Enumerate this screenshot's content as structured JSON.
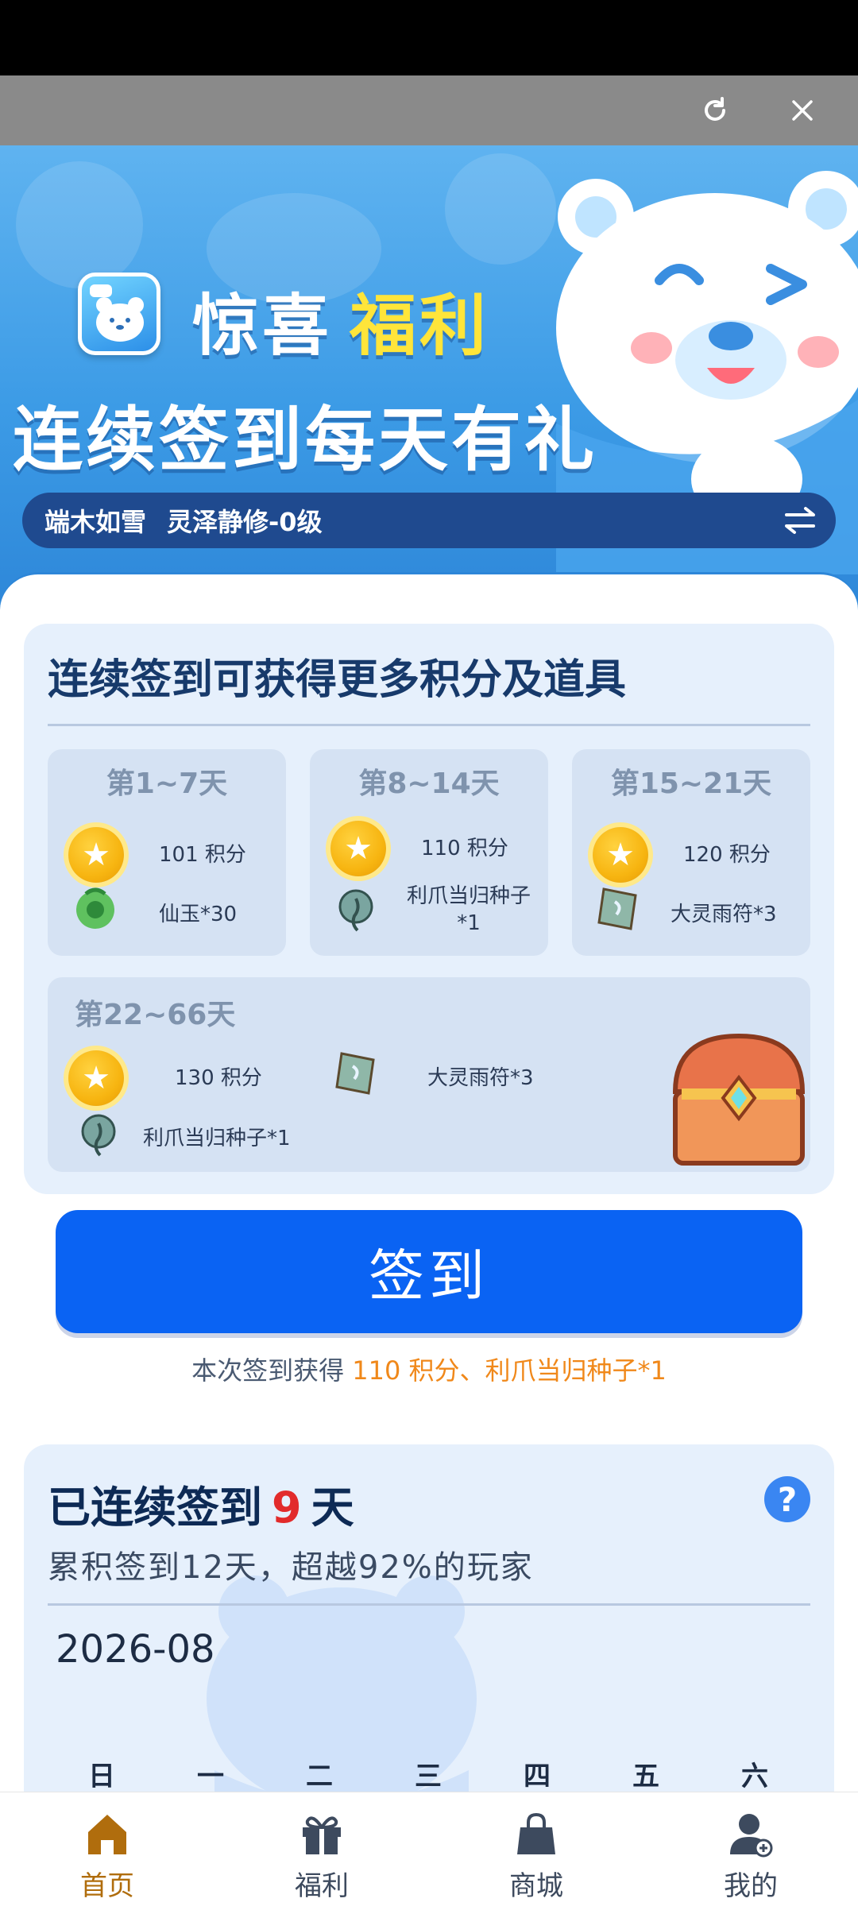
{
  "banner": {
    "title_part1": "惊喜",
    "title_part2": "福利",
    "subtitle": "连续签到每天有礼",
    "user_name": "端木如雪",
    "user_role": "灵泽静修-0级"
  },
  "rewards": {
    "title": "连续签到可获得更多积分及道具",
    "tiers": [
      {
        "label": "第1~7天",
        "points": "101 积分",
        "item": "仙玉*30"
      },
      {
        "label": "第8~14天",
        "points": "110 积分",
        "item_line1": "利爪当归种子",
        "item_line2": "*1"
      },
      {
        "label": "第15~21天",
        "points": "120 积分",
        "item": "大灵雨符*3"
      }
    ],
    "big_tier": {
      "label": "第22~66天",
      "points": "130 积分",
      "item_a": "大灵雨符*3",
      "item_b": "利爪当归种子*1"
    }
  },
  "signin": {
    "button_label": "签到",
    "gain_prefix": "本次签到获得",
    "gain_value": "110 积分、利爪当归种子*1"
  },
  "streak": {
    "title_prefix": "已连续签到",
    "days": "9",
    "title_suffix": "天",
    "subtitle": "累积签到12天，超越92%的玩家",
    "month": "2026-08",
    "weekdays": [
      "日",
      "一",
      "二",
      "三",
      "四",
      "五",
      "六"
    ]
  },
  "nav": {
    "items": [
      {
        "label": "首页",
        "icon": "home-icon",
        "active": true
      },
      {
        "label": "福利",
        "icon": "gift-icon",
        "active": false
      },
      {
        "label": "商城",
        "icon": "shop-bag-icon",
        "active": false
      },
      {
        "label": "我的",
        "icon": "user-icon",
        "active": false
      }
    ]
  },
  "colors": {
    "primary_button": "#0a63f3",
    "highlight_yellow": "#ffe53a",
    "gain_orange": "#f0881a",
    "streak_red": "#e22b2b",
    "nav_active": "#b06d0d"
  }
}
